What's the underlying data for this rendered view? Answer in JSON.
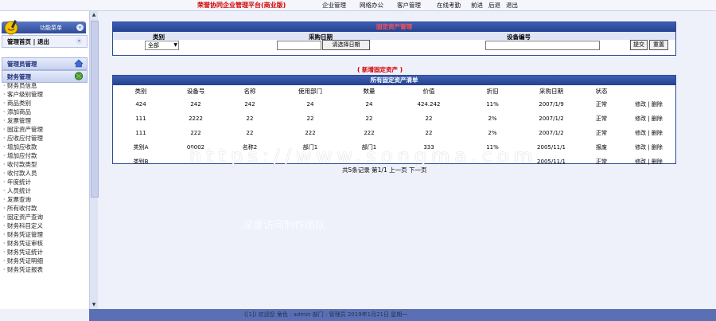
{
  "topbar": {
    "title": "荣誉协同企业管理平台(商业版)",
    "nav": [
      "企业管理",
      "网络办公",
      "客户管理",
      "在线考勤",
      "前进",
      "后退",
      "退出"
    ]
  },
  "sidebar": {
    "head_label": "功能菜单",
    "head_icon": "«",
    "user_row": {
      "home": "管理首页",
      "sep": "|",
      "logout": "退出",
      "icon": "«"
    },
    "sections": [
      "管理员管理",
      "财务管理"
    ],
    "items": [
      "财务员信息",
      "客户级别管理",
      "商品类别",
      "添加商品",
      "发票管理",
      "固定资产管理",
      "应收应付管理",
      "增加应收款",
      "增加应付款",
      "收付款类型",
      "收付款人员",
      "年度统计",
      "人员统计",
      "发票查询",
      "所有收付款",
      "固定资产查询",
      "财务科目定义",
      "财务凭证管理",
      "财务凭证审核",
      "财务凭证统计",
      "财务凭证明细",
      "财务凭证报表"
    ]
  },
  "search": {
    "header": "固定资产管理",
    "labels": {
      "category": "类别",
      "purchase_date": "采购日期",
      "device_no": "设备编号"
    },
    "category_value": "全部",
    "date_value": "",
    "date_button": "请选择日期",
    "device_value": "",
    "submit": "提交",
    "reset": "重置"
  },
  "add_link": "(  新增固定资产  )",
  "list": {
    "header": "所有固定资产清单",
    "columns": [
      "类别",
      "设备号",
      "名称",
      "使用部门",
      "数量",
      "价值",
      "折旧",
      "采购日期",
      "状态",
      ""
    ],
    "rows": [
      [
        "424",
        "242",
        "242",
        "24",
        "24",
        "424.242",
        "11%",
        "2007/1/9",
        "正常"
      ],
      [
        "111",
        "2222",
        "22",
        "22",
        "22",
        "22",
        "2%",
        "2007/1/2",
        "正常"
      ],
      [
        "111",
        "222",
        "22",
        "222",
        "222",
        "22",
        "2%",
        "2007/1/2",
        "正常"
      ],
      [
        "类别A",
        "00002",
        "名称2",
        "部门1",
        "部门1",
        "333",
        "11%",
        "2005/11/1",
        "报废"
      ],
      [
        "类别B",
        "",
        "",
        "",
        "",
        "",
        "",
        "2005/11/1",
        "正常"
      ]
    ],
    "edit": "修改",
    "sep": "|",
    "delete": "删除"
  },
  "pager": "共5条记录    第1/1 上一页  下一页",
  "watermarks": {
    "url": "https://www.songma.com",
    "cn": "深度访问制作团队"
  },
  "status": "([1]) 欢迎您  角色 : admin  部门 : 管理员    2019年1月21日 星期一",
  "colors": {
    "accent": "#2c4a98",
    "title_red": "#d40000",
    "background": "#eef0fa"
  }
}
